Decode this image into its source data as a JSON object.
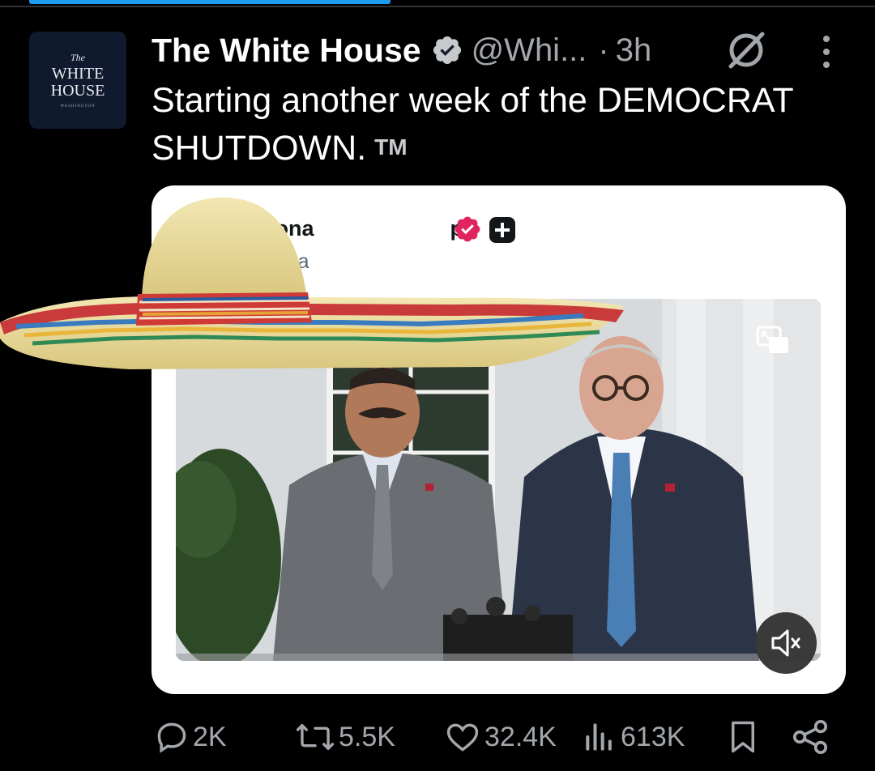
{
  "post": {
    "author_name": "The White House",
    "handle": "@Whi...",
    "separator": "·",
    "time": "3h",
    "text": "Starting another week of the DEMOCRAT SHUTDOWN.",
    "trademark": "TM",
    "avatar": {
      "line1": "The",
      "line2": "WHITE",
      "line3": "HOUSE",
      "line4": "WASHINGTON"
    }
  },
  "embedded_post": {
    "name": "Dona",
    "name_end": "p",
    "handle": "@rea"
  },
  "stats": {
    "replies": "2K",
    "reposts": "5.5K",
    "likes": "32.4K",
    "views": "613K"
  },
  "colors": {
    "background": "#000000",
    "accent": "#1d9bf0",
    "verified": "#1d9bf0",
    "muted_text": "#a3a7ac",
    "embed_badge": "#e0245e"
  },
  "icons": [
    "verified-badge-icon",
    "grok-icon",
    "more-icon",
    "picture-in-picture-icon",
    "mute-icon",
    "reply-icon",
    "repost-icon",
    "like-icon",
    "views-icon",
    "bookmark-icon",
    "share-icon"
  ]
}
